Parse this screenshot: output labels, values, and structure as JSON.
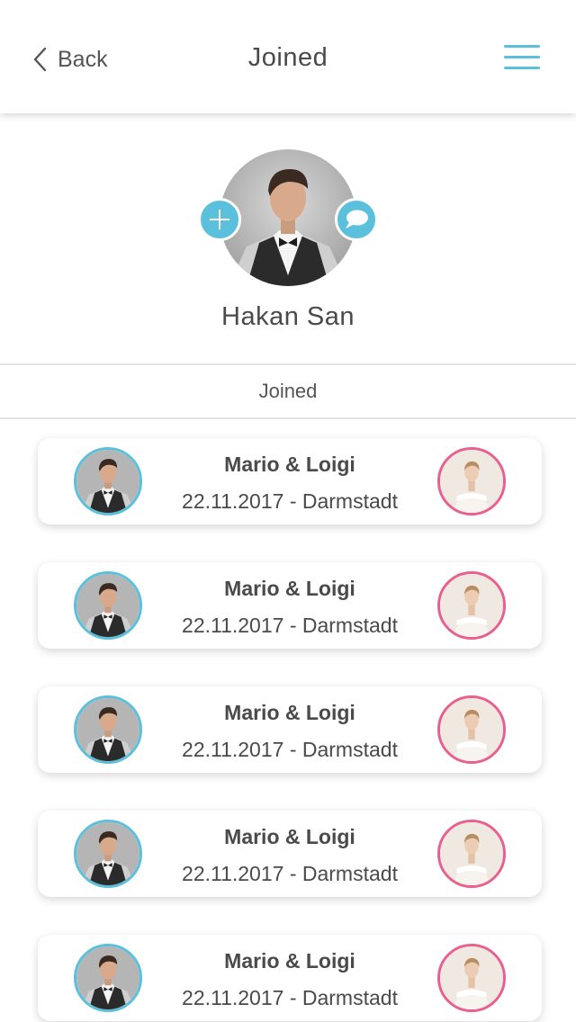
{
  "header": {
    "back_label": "Back",
    "title": "Joined"
  },
  "profile": {
    "name": "Hakan San"
  },
  "section": {
    "label": "Joined"
  },
  "cards": [
    {
      "title": "Mario & Loigi",
      "subtitle": "22.11.2017 - Darmstadt"
    },
    {
      "title": "Mario & Loigi",
      "subtitle": "22.11.2017 - Darmstadt"
    },
    {
      "title": "Mario & Loigi",
      "subtitle": "22.11.2017 - Darmstadt"
    },
    {
      "title": "Mario & Loigi",
      "subtitle": "22.11.2017 - Darmstadt"
    },
    {
      "title": "Mario & Loigi",
      "subtitle": "22.11.2017 - Darmstadt"
    }
  ],
  "colors": {
    "accent": "#5bc0dc",
    "bride_ring": "#e9608e",
    "text": "#4a4a4a"
  },
  "icons": {
    "back": "chevron-left-icon",
    "menu": "hamburger-menu-icon",
    "add": "plus-icon",
    "chat": "speech-bubble-icon"
  }
}
